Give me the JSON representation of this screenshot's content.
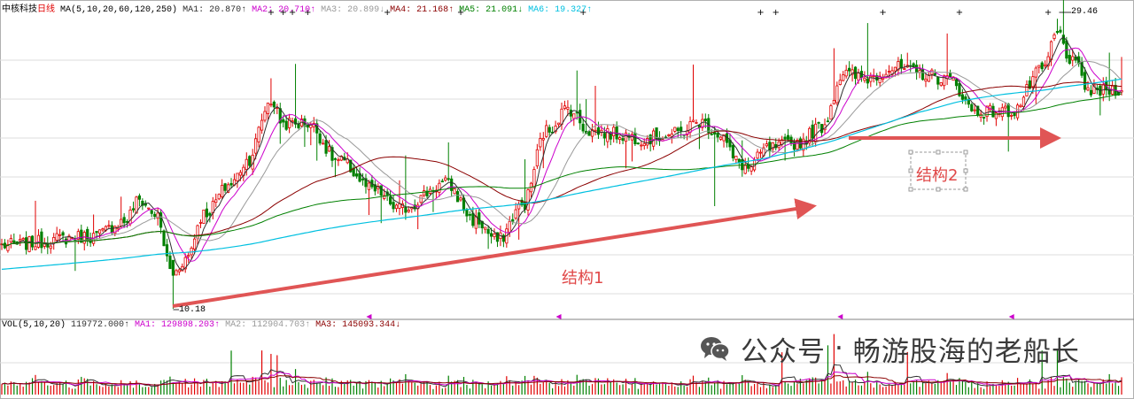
{
  "chart_data": {
    "type": "candlestick",
    "stock": {
      "name": "中核科技",
      "period": "日线"
    },
    "price_legend": {
      "label": "MA(5,10,20,60,120,250)",
      "items": [
        {
          "text": "MA1: 20.870↑",
          "color": "#303030"
        },
        {
          "text": "MA2: 20.710↑",
          "color": "#cc00cc"
        },
        {
          "text": "MA3: 20.899↓",
          "color": "#999999"
        },
        {
          "text": "MA4: 21.168↑",
          "color": "#8b0000"
        },
        {
          "text": "MA5: 21.091↓",
          "color": "#008000"
        },
        {
          "text": "MA6: 19.327↑",
          "color": "#00c0e0"
        }
      ]
    },
    "volume_legend": {
      "label": "VOL(5,10,20)",
      "items": [
        {
          "text": "119772.000↑",
          "color": "#303030"
        },
        {
          "text": "MA1: 129898.203↑",
          "color": "#cc00cc"
        },
        {
          "text": "MA2: 112904.703↑",
          "color": "#999999"
        },
        {
          "text": "MA3: 145093.344↓",
          "color": "#8b0000"
        }
      ]
    },
    "annotations": {
      "low_price": "10.18",
      "high_price": "29.46",
      "structure1": "结构1",
      "structure2": "结构2"
    },
    "anchors": [
      {
        "i": 0,
        "c": 14.4
      },
      {
        "i": 30,
        "c": 15.0
      },
      {
        "i": 40,
        "c": 16.0
      },
      {
        "i": 45,
        "c": 17.4
      },
      {
        "i": 50,
        "c": 16.5
      },
      {
        "i": 56,
        "c": 12.5
      },
      {
        "i": 60,
        "c": 13.5
      },
      {
        "i": 66,
        "c": 16.5
      },
      {
        "i": 75,
        "c": 18.5
      },
      {
        "i": 80,
        "c": 20.0
      },
      {
        "i": 88,
        "c": 24.0
      },
      {
        "i": 92,
        "c": 22.5
      },
      {
        "i": 100,
        "c": 22.5
      },
      {
        "i": 110,
        "c": 20.0
      },
      {
        "i": 122,
        "c": 18.0
      },
      {
        "i": 130,
        "c": 16.8
      },
      {
        "i": 145,
        "c": 18.5
      },
      {
        "i": 155,
        "c": 16.0
      },
      {
        "i": 162,
        "c": 14.7
      },
      {
        "i": 170,
        "c": 17.0
      },
      {
        "i": 178,
        "c": 22.0
      },
      {
        "i": 185,
        "c": 23.5
      },
      {
        "i": 192,
        "c": 22.0
      },
      {
        "i": 200,
        "c": 21.8
      },
      {
        "i": 210,
        "c": 21.5
      },
      {
        "i": 220,
        "c": 21.8
      },
      {
        "i": 228,
        "c": 22.6
      },
      {
        "i": 235,
        "c": 21.8
      },
      {
        "i": 240,
        "c": 20.0
      },
      {
        "i": 244,
        "c": 19.5
      },
      {
        "i": 250,
        "c": 20.8
      },
      {
        "i": 260,
        "c": 21.2
      },
      {
        "i": 268,
        "c": 22.3
      },
      {
        "i": 275,
        "c": 25.8
      },
      {
        "i": 282,
        "c": 25.5
      },
      {
        "i": 292,
        "c": 26.2
      },
      {
        "i": 300,
        "c": 25.8
      },
      {
        "i": 310,
        "c": 25.4
      },
      {
        "i": 318,
        "c": 23.3
      },
      {
        "i": 330,
        "c": 23.3
      },
      {
        "i": 340,
        "c": 26.0
      },
      {
        "i": 345,
        "c": 28.5
      },
      {
        "i": 350,
        "c": 26.5
      },
      {
        "i": 356,
        "c": 24.6
      },
      {
        "i": 366,
        "c": 24.8
      }
    ],
    "price_axis": {
      "min": 10,
      "max": 30
    },
    "volume_axis": {
      "min": 0,
      "max": 600000
    },
    "marker_counts": {
      "plus": 12,
      "purple_triangles": 5
    }
  }
}
